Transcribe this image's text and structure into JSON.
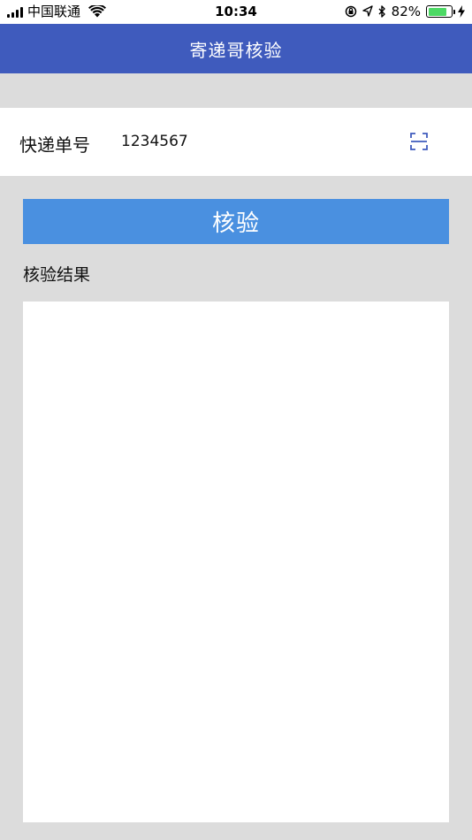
{
  "status_bar": {
    "carrier": "中国联通",
    "time": "10:34",
    "battery_percent": "82%",
    "battery_level": 0.82,
    "icons": [
      "signal-icon",
      "wifi-icon",
      "lock-rotation-icon",
      "location-icon",
      "bluetooth-icon",
      "battery-icon",
      "charging-icon"
    ]
  },
  "nav": {
    "title": "寄递哥核验"
  },
  "form": {
    "label": "快递单号",
    "value": "1234567",
    "scan_icon": "scan-icon"
  },
  "actions": {
    "verify_label": "核验"
  },
  "result": {
    "label": "核验结果"
  },
  "colors": {
    "nav_bg": "#3f5bbd",
    "button_bg": "#4a90e0",
    "page_bg": "#dcdcdc",
    "battery_fill": "#4cd964"
  }
}
